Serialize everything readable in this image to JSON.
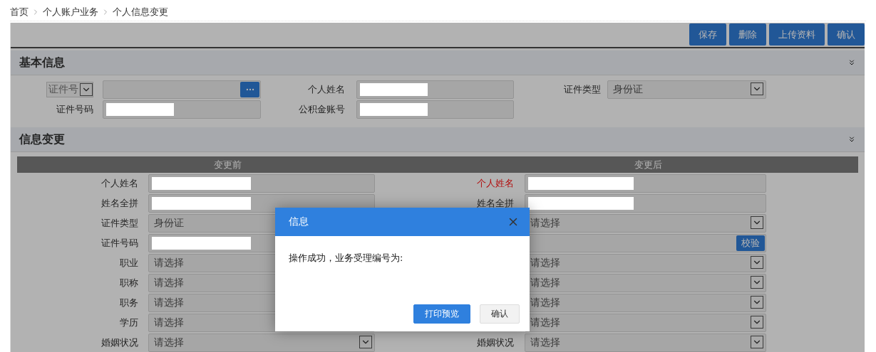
{
  "breadcrumb": [
    "首页",
    "个人账户业务",
    "个人信息变更"
  ],
  "toolbar": {
    "buttons": [
      "保存",
      "删除",
      "上传资料",
      "确认"
    ]
  },
  "basic_info": {
    "title": "基本信息",
    "fields": [
      {
        "kind": "id-lookup",
        "label": "证件号"
      },
      {
        "kind": "text",
        "label": "个人姓名",
        "redacted": true
      },
      {
        "kind": "select",
        "label": "证件类型",
        "value": "身份证"
      },
      {
        "kind": "text",
        "label": "证件号码",
        "redacted": true
      },
      {
        "kind": "text",
        "label": "公积金账号",
        "redacted": true
      }
    ]
  },
  "change": {
    "title": "信息变更",
    "before_heading": "变更前",
    "after_heading": "变更后",
    "rows": [
      {
        "before": {
          "kind": "text",
          "label": "个人姓名",
          "required": false,
          "redacted": true
        },
        "after": {
          "kind": "text",
          "label": "个人姓名",
          "required": true,
          "redacted": true
        }
      },
      {
        "before": {
          "kind": "text",
          "label": "姓名全拼",
          "required": false,
          "redacted": true
        },
        "after": {
          "kind": "text",
          "label": "姓名全拼",
          "required": false,
          "redacted": true
        }
      },
      {
        "before": {
          "kind": "select",
          "label": "证件类型",
          "required": false,
          "value": "身份证",
          "caret": false
        },
        "after": {
          "kind": "select",
          "placeholder": "请选择",
          "caret": true
        }
      },
      {
        "before": {
          "kind": "text",
          "label": "证件号码",
          "required": false,
          "redacted": true
        },
        "after": {
          "kind": "verify",
          "button": "校验"
        }
      },
      {
        "before": {
          "kind": "select",
          "label": "职业",
          "required": false,
          "placeholder": "请选择",
          "caret": false
        },
        "after": {
          "kind": "select",
          "placeholder": "请选择",
          "caret": true
        }
      },
      {
        "before": {
          "kind": "select",
          "label": "职称",
          "required": false,
          "placeholder": "请选择",
          "caret": false
        },
        "after": {
          "kind": "select",
          "placeholder": "请选择",
          "caret": true
        }
      },
      {
        "before": {
          "kind": "select",
          "label": "职务",
          "required": false,
          "placeholder": "请选择",
          "caret": false
        },
        "after": {
          "kind": "select",
          "placeholder": "请选择",
          "caret": true
        }
      },
      {
        "before": {
          "kind": "select",
          "label": "学历",
          "required": false,
          "placeholder": "请选择",
          "caret": false
        },
        "after": {
          "kind": "select",
          "placeholder": "请选择",
          "caret": true
        }
      },
      {
        "before": {
          "kind": "select",
          "label": "婚姻状况",
          "required": false,
          "placeholder": "请选择",
          "caret": true
        },
        "after": {
          "kind": "select",
          "label": "婚姻状况",
          "required": false,
          "placeholder": "请选择",
          "caret": true
        }
      }
    ]
  },
  "dialog": {
    "title": "信息",
    "message": "操作成功，业务受理编号为:",
    "buttons": [
      {
        "label": "打印预览",
        "primary": true
      },
      {
        "label": "确认",
        "primary": false
      }
    ]
  }
}
